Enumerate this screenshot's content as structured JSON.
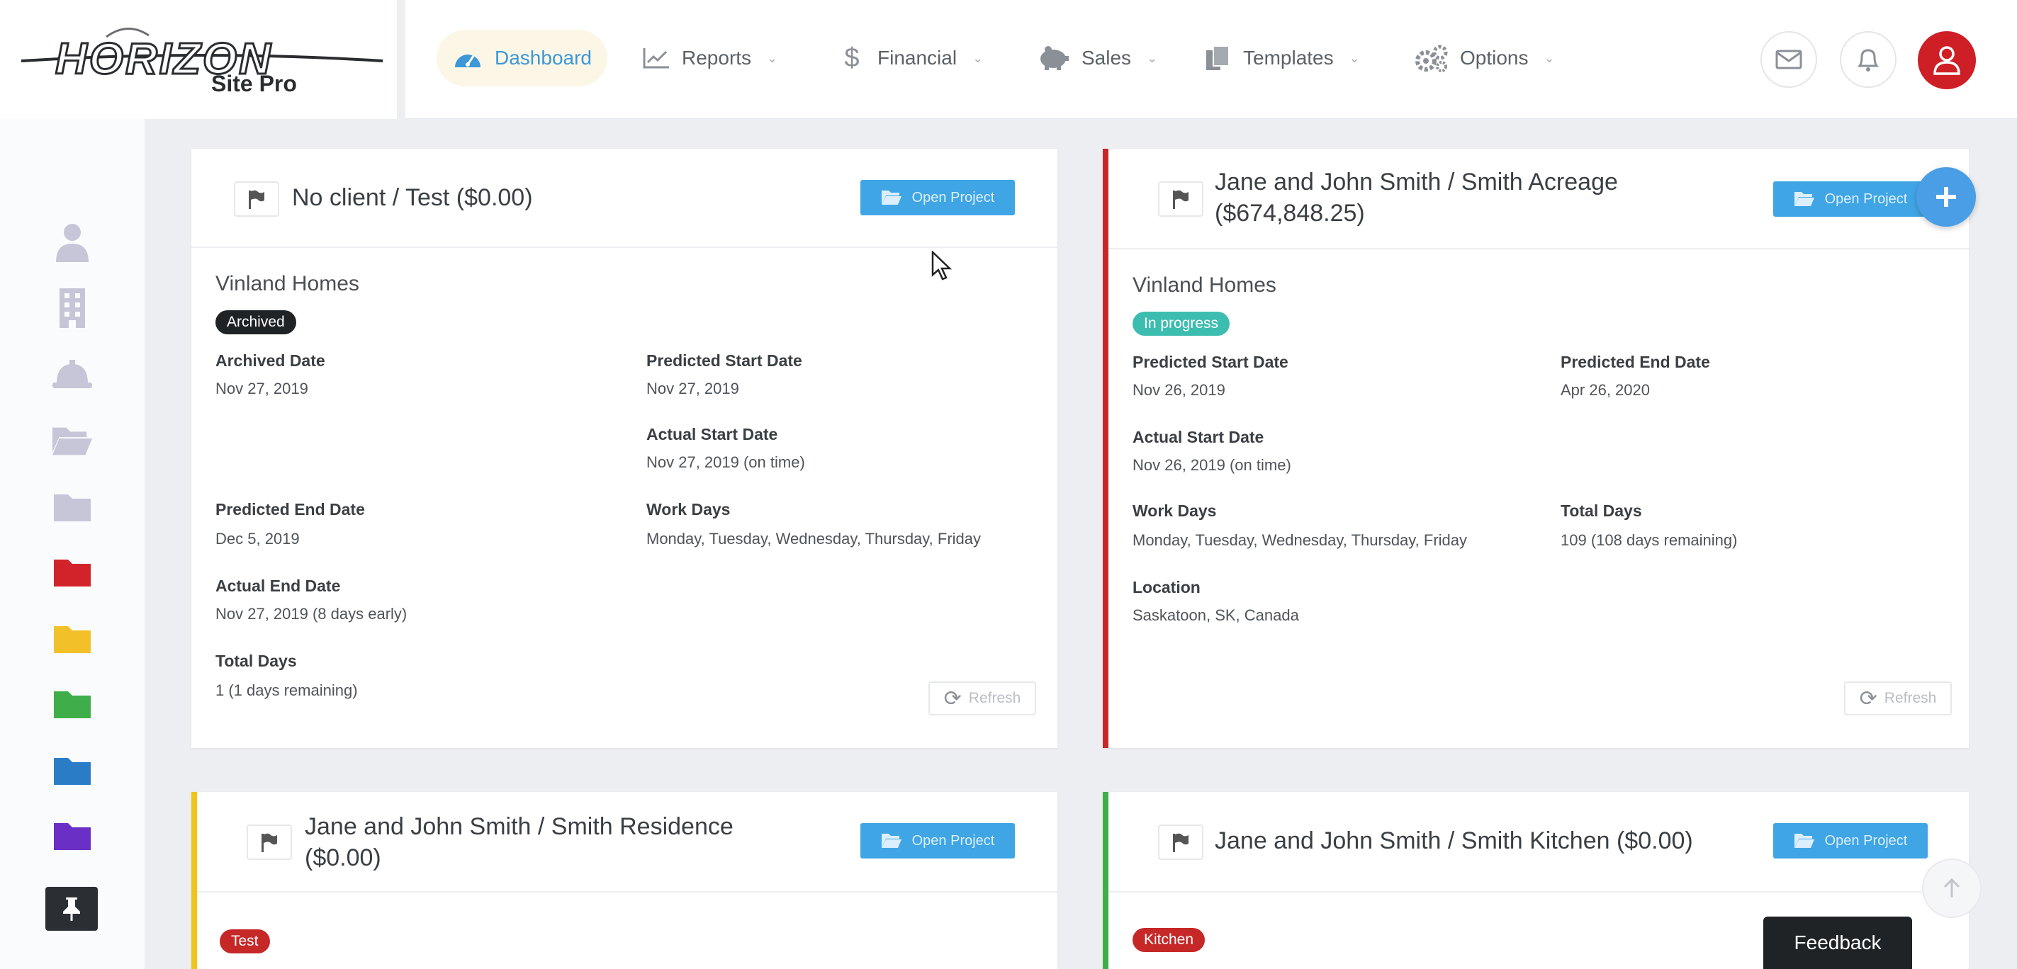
{
  "brand": {
    "name": "HORIZON",
    "tagline": "Site Pro"
  },
  "nav": {
    "items": [
      {
        "label": "Dashboard",
        "icon": "speedometer-icon",
        "active": true
      },
      {
        "label": "Reports",
        "icon": "line-chart-icon"
      },
      {
        "label": "Financial",
        "icon": "dollar-icon"
      },
      {
        "label": "Sales",
        "icon": "piggy-bank-icon"
      },
      {
        "label": "Templates",
        "icon": "copy-icon"
      },
      {
        "label": "Options",
        "icon": "gears-icon"
      }
    ],
    "right_icons": [
      "mail-icon",
      "bell-icon",
      "user-avatar-icon"
    ]
  },
  "sidebar": {
    "items": [
      {
        "icon": "person-icon",
        "color": "#c6c6d8"
      },
      {
        "icon": "building-icon",
        "color": "#c6c6d8"
      },
      {
        "icon": "hard-hat-icon",
        "color": "#c6c6d8"
      },
      {
        "icon": "folder-open-icon",
        "color": "#c6c6d8"
      },
      {
        "icon": "folder-icon",
        "color": "#c6c6d8"
      },
      {
        "icon": "folder-red-icon",
        "color": "#d3232a"
      },
      {
        "icon": "folder-yellow-icon",
        "color": "#f2c12a"
      },
      {
        "icon": "folder-green-icon",
        "color": "#3fae49"
      },
      {
        "icon": "folder-blue-icon",
        "color": "#2a7cc7"
      },
      {
        "icon": "folder-purple-icon",
        "color": "#6a2fc4"
      },
      {
        "icon": "pin-icon",
        "color": "#2b2f33"
      }
    ]
  },
  "cards": [
    {
      "title": "No client / Test ($0.00)",
      "open_label": "Open Project",
      "company": "Vinland Homes",
      "status": "Archived",
      "status_color": "#1f2326",
      "fields": {
        "archived_date_label": "Archived Date",
        "archived_date": "Nov 27, 2019",
        "pred_start_label": "Predicted Start Date",
        "pred_start": "Nov 27, 2019",
        "actual_start_label": "Actual Start Date",
        "actual_start": "Nov 27, 2019 (on time)",
        "pred_end_label": "Predicted End Date",
        "pred_end": "Dec 5, 2019",
        "work_days_label": "Work Days",
        "work_days": "Monday, Tuesday, Wednesday, Thursday, Friday",
        "actual_end_label": "Actual End Date",
        "actual_end": "Nov 27, 2019 (8 days early)",
        "total_days_label": "Total Days",
        "total_days": "1 (1 days remaining)"
      },
      "refresh_label": "Refresh"
    },
    {
      "title_line1": "Jane and John Smith   / Smith Acreage",
      "title_line2": "($674,848.25)",
      "accent": "#c62828",
      "open_label": "Open Project",
      "company": "Vinland Homes",
      "status": "In progress",
      "status_color": "#3dbdb0",
      "fields": {
        "pred_start_label": "Predicted Start Date",
        "pred_start": "Nov 26, 2019",
        "pred_end_label": "Predicted End Date",
        "pred_end": "Apr 26, 2020",
        "actual_start_label": "Actual Start Date",
        "actual_start": "Nov 26, 2019 (on time)",
        "work_days_label": "Work Days",
        "work_days": "Monday, Tuesday, Wednesday, Thursday, Friday",
        "total_days_label": "Total Days",
        "total_days": "109 (108 days remaining)",
        "location_label": "Location",
        "location": "Saskatoon, SK, Canada"
      },
      "refresh_label": "Refresh"
    },
    {
      "title_line1": "Jane and John Smith   / Smith Residence",
      "title_line2": "($0.00)",
      "accent": "#f0c419",
      "open_label": "Open Project",
      "status": "Test",
      "status_color": "#c62828"
    },
    {
      "title": "Jane and John Smith   / Smith Kitchen ($0.00)",
      "accent": "#3fae49",
      "open_label": "Open Project",
      "status": "Kitchen",
      "status_color": "#c62828"
    }
  ],
  "feedback_label": "Feedback"
}
